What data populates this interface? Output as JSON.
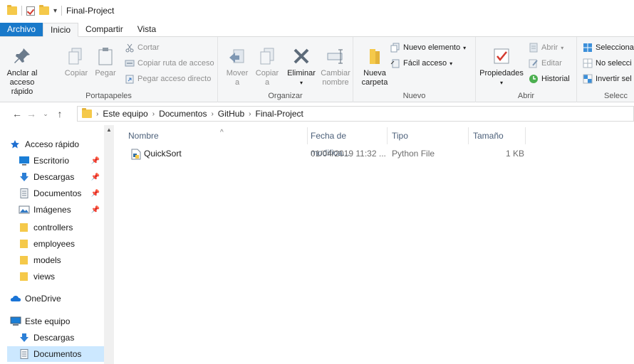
{
  "window": {
    "title": "Final-Project"
  },
  "ribbon_tabs": [
    "Archivo",
    "Inicio",
    "Compartir",
    "Vista"
  ],
  "ribbon": {
    "portapapeles": {
      "anclar": "Anclar al\nacceso rápido",
      "copiar": "Copiar",
      "pegar": "Pegar",
      "cortar": "Cortar",
      "copiar_ruta": "Copiar ruta de acceso",
      "pegar_acceso": "Pegar acceso directo",
      "label": "Portapapeles"
    },
    "organizar": {
      "mover": "Mover\na",
      "copiar": "Copiar\na",
      "eliminar": "Eliminar",
      "cambiar": "Cambiar\nnombre",
      "label": "Organizar"
    },
    "nuevo": {
      "nueva_carpeta": "Nueva\ncarpeta",
      "nuevo_elemento": "Nuevo elemento",
      "facil_acceso": "Fácil acceso",
      "label": "Nuevo"
    },
    "abrir": {
      "propiedades": "Propiedades",
      "abrir": "Abrir",
      "editar": "Editar",
      "historial": "Historial",
      "label": "Abrir"
    },
    "seleccionar": {
      "sel_todo": "Selecciona",
      "no_sel": "No selecci",
      "invertir": "Invertir sel",
      "label": "Selecc"
    }
  },
  "breadcrumb": [
    "Este equipo",
    "Documentos",
    "GitHub",
    "Final-Project"
  ],
  "nav": {
    "quick_access": "Acceso rápido",
    "items": [
      {
        "label": "Escritorio",
        "pinned": true,
        "icon": "desktop-icon"
      },
      {
        "label": "Descargas",
        "pinned": true,
        "icon": "download-icon"
      },
      {
        "label": "Documentos",
        "pinned": true,
        "icon": "documents-icon"
      },
      {
        "label": "Imágenes",
        "pinned": true,
        "icon": "pictures-icon"
      },
      {
        "label": "controllers",
        "pinned": false,
        "icon": "folder-icon"
      },
      {
        "label": "employees",
        "pinned": false,
        "icon": "folder-icon"
      },
      {
        "label": "models",
        "pinned": false,
        "icon": "folder-icon"
      },
      {
        "label": "views",
        "pinned": false,
        "icon": "folder-icon"
      }
    ],
    "onedrive": "OneDrive",
    "this_pc": "Este equipo",
    "pc_items": [
      {
        "label": "Descargas",
        "icon": "download-icon"
      },
      {
        "label": "Documentos",
        "icon": "documents-icon",
        "selected": true
      }
    ]
  },
  "columns": [
    "Nombre",
    "Fecha de modifica...",
    "Tipo",
    "Tamaño"
  ],
  "files": [
    {
      "name": "QuickSort",
      "modified": "01/04/2019 11:32 ...",
      "type": "Python File",
      "size": "1 KB"
    }
  ],
  "colors": {
    "file_tab": "#1979ca",
    "selected": "#cce8ff",
    "folder": "#f5c94a"
  }
}
